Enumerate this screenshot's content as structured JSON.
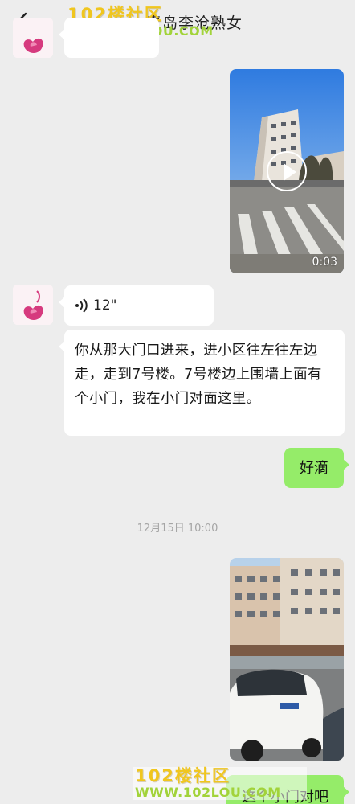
{
  "header": {
    "title": "青岛李沧熟女"
  },
  "watermark": {
    "brand": "102楼社区",
    "url": "WWW.102LOU.COM"
  },
  "messages": [
    {
      "type": "video",
      "side": "right",
      "duration": "0:03"
    },
    {
      "type": "voice",
      "side": "left",
      "duration": "12\""
    },
    {
      "type": "text",
      "side": "left",
      "text": "你从那大门口进来，进小区往左往左边走，走到7号楼。7号楼边上围墙上面有个小门，我在小门对面这里。"
    },
    {
      "type": "text",
      "side": "right",
      "text": "好滴"
    },
    {
      "type": "timestamp",
      "text": "12月15日 10:00"
    },
    {
      "type": "video",
      "side": "right"
    },
    {
      "type": "text",
      "side": "right",
      "text": "这个小门对吧",
      "partial": true
    }
  ],
  "colors": {
    "background": "#ededed",
    "bubble_self": "#95ec69",
    "bubble_other": "#ffffff",
    "watermark_brand": "#f0c61e",
    "watermark_url": "#a2d33a"
  }
}
